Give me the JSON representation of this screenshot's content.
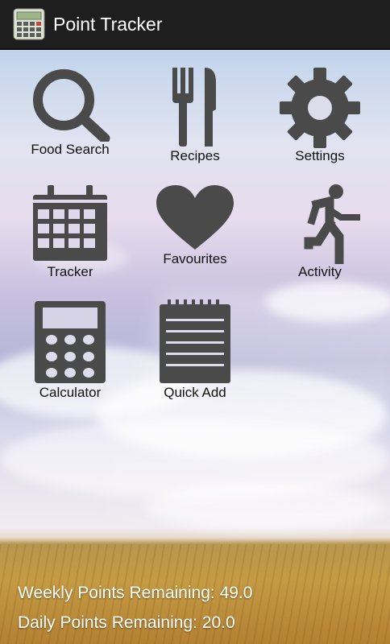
{
  "action_bar": {
    "title": "Point Tracker"
  },
  "menu": {
    "food_search": "Food Search",
    "recipes": "Recipes",
    "settings": "Settings",
    "tracker": "Tracker",
    "favourites": "Favourites",
    "activity": "Activity",
    "calculator": "Calculator",
    "quick_add": "Quick Add"
  },
  "status": {
    "weekly_label": "Weekly Points Remaining:",
    "weekly_value": "49.0",
    "daily_label": "Daily Points Remaining:",
    "daily_value": "20.0"
  },
  "colors": {
    "icon": "#4a4a4a",
    "action_bar": "#1e1e1e",
    "footer_text": "#ffffff"
  },
  "icons": {
    "app": "calculator-icon",
    "food_search": "magnifier-icon",
    "recipes": "fork-knife-icon",
    "settings": "gear-icon",
    "tracker": "calendar-icon",
    "favourites": "heart-icon",
    "activity": "running-person-icon",
    "calculator": "calculator-icon",
    "quick_add": "notepad-icon"
  }
}
